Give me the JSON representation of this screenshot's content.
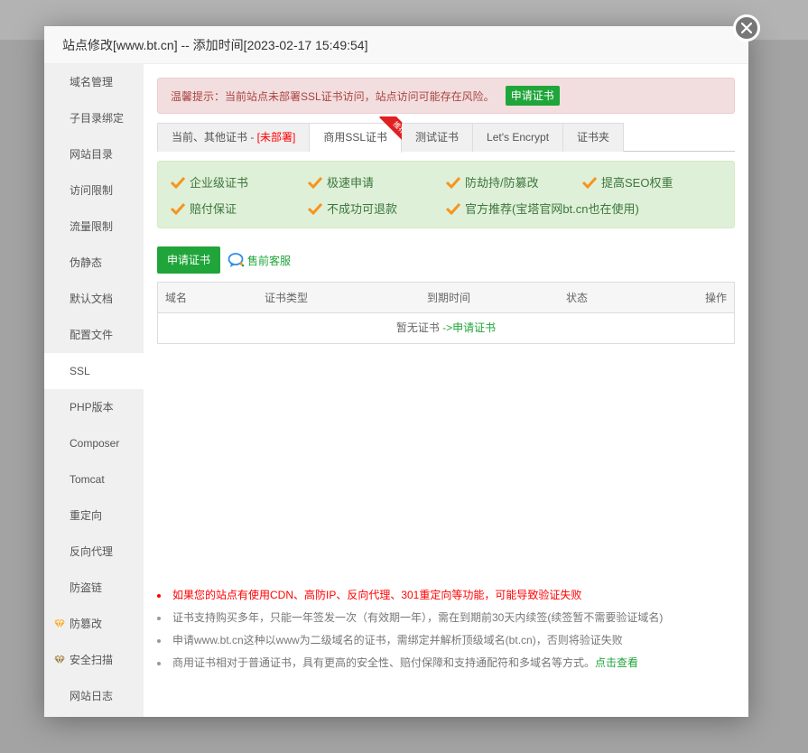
{
  "dialog": {
    "title": "站点修改[www.bt.cn] -- 添加时间[2023-02-17 15:49:54]",
    "close_icon": "close-icon"
  },
  "sidebar": {
    "items": [
      {
        "label": "域名管理",
        "active": false
      },
      {
        "label": "子目录绑定",
        "active": false
      },
      {
        "label": "网站目录",
        "active": false
      },
      {
        "label": "访问限制",
        "active": false
      },
      {
        "label": "流量限制",
        "active": false
      },
      {
        "label": "伪静态",
        "active": false
      },
      {
        "label": "默认文档",
        "active": false
      },
      {
        "label": "配置文件",
        "active": false
      },
      {
        "label": "SSL",
        "active": true
      },
      {
        "label": "PHP版本",
        "active": false
      },
      {
        "label": "Composer",
        "active": false
      },
      {
        "label": "Tomcat",
        "active": false
      },
      {
        "label": "重定向",
        "active": false
      },
      {
        "label": "反向代理",
        "active": false
      },
      {
        "label": "防盗链",
        "active": false
      },
      {
        "label": "防篡改",
        "active": false,
        "icon": "gem-icon",
        "icon_color": "#f5a623"
      },
      {
        "label": "安全扫描",
        "active": false,
        "icon": "gem-icon",
        "icon_color": "#9a7b3f"
      },
      {
        "label": "网站日志",
        "active": false
      }
    ]
  },
  "alert": {
    "text": "温馨提示：当前站点未部署SSL证书访问，站点访问可能存在风险。",
    "button_label": "申请证书"
  },
  "tabs": [
    {
      "label": "当前、其他证书 - ",
      "status": "[未部署]",
      "active": false
    },
    {
      "label": "商用SSL证书",
      "badge": "推荐",
      "active": true
    },
    {
      "label": "测试证书",
      "active": false
    },
    {
      "label": "Let's Encrypt",
      "active": false
    },
    {
      "label": "证书夹",
      "active": false
    }
  ],
  "features": [
    "企业级证书",
    "极速申请",
    "防劫持/防篡改",
    "提高SEO权重",
    "赔付保证",
    "不成功可退款",
    "官方推荐(宝塔官网bt.cn也在使用)"
  ],
  "actions": {
    "apply_label": "申请证书",
    "presale_label": "售前客服"
  },
  "table": {
    "columns": [
      "域名",
      "证书类型",
      "到期时间",
      "状态",
      "操作"
    ],
    "empty_text": "暂无证书 ",
    "empty_link": "->申请证书"
  },
  "notes": [
    {
      "text": "如果您的站点有使用CDN、高防IP、反向代理、301重定向等功能，可能导致验证失败",
      "warn": true
    },
    {
      "text": "证书支持购买多年，只能一年签发一次（有效期一年），需在到期前30天内续签(续签暂不需要验证域名)",
      "warn": false
    },
    {
      "text": "申请www.bt.cn这种以www为二级域名的证书，需绑定并解析顶级域名(bt.cn)，否则将验证失败",
      "warn": false
    },
    {
      "text": "商用证书相对于普通证书，具有更高的安全性、赔付保障和支持通配符和多域名等方式。",
      "link": "点击查看",
      "warn": false
    }
  ],
  "colors": {
    "accent_green": "#20a53a",
    "warning_red": "#ff0000",
    "alert_bg": "#f2dede",
    "feature_bg": "#dff0d8",
    "check_orange": "#f7941d"
  }
}
